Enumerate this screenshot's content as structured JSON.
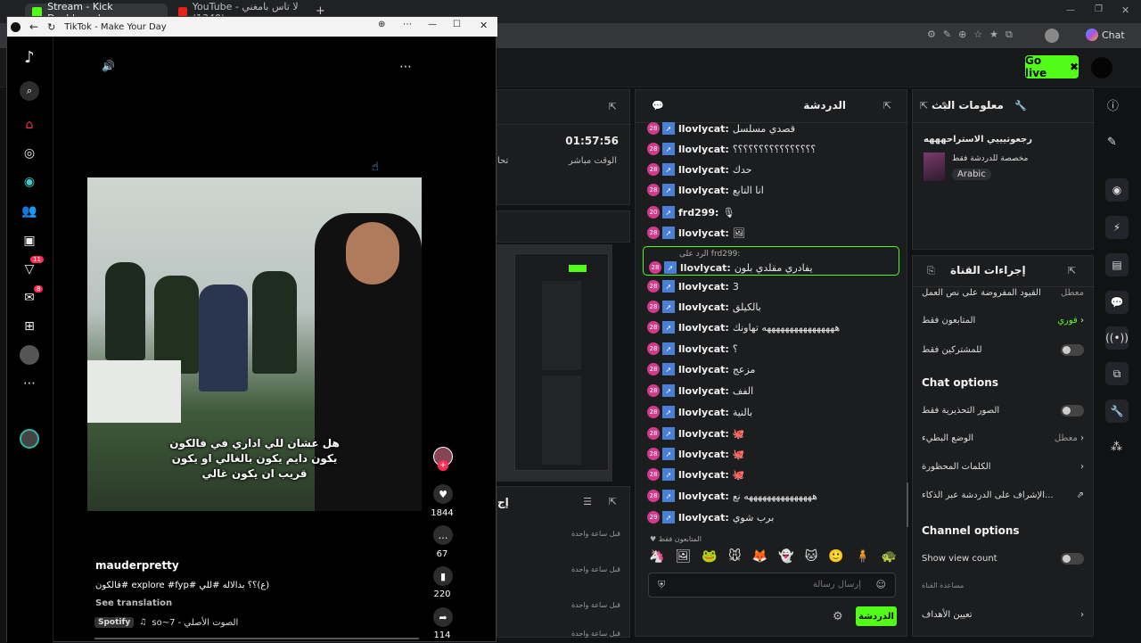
{
  "browser": {
    "tabs": [
      {
        "label": "Stream - Kick Dashboard"
      },
      {
        "label": "YouTube - لا تاس بامغني (1340)"
      }
    ],
    "new_tab": "+",
    "copilot": "Chat"
  },
  "kick": {
    "go_live": "Go live",
    "stats": {
      "time": "01:57:56",
      "time_label": "الوقت مباشر",
      "other_label": "تحا"
    },
    "stream_info": {
      "title": "معلومات البث",
      "stream_title": "رجعوتيييي الاستراحهههه",
      "category": "مخصصة للدردشة فقط",
      "language": "Arabic"
    },
    "chat": {
      "title": "الدردشة",
      "messages": [
        {
          "badge": "28",
          "user": "llovlycat:",
          "text": "قصدي مسلسل"
        },
        {
          "badge": "28",
          "user": "llovlycat:",
          "text": "؟؟؟؟؟؟؟؟؟؟؟؟؟؟؟؟"
        },
        {
          "badge": "28",
          "user": "llovlycat:",
          "text": "حدك"
        },
        {
          "badge": "28",
          "user": "llovlycat:",
          "text": "انا التابع"
        },
        {
          "badge": "20",
          "user": "frd299:",
          "text": "🎙"
        },
        {
          "badge": "28",
          "user": "llovlycat:",
          "text": "🖼"
        },
        {
          "badge": "28",
          "user": "llovlycat:",
          "text": "3"
        },
        {
          "badge": "28",
          "user": "llovlycat:",
          "text": "بالكيلق"
        },
        {
          "badge": "28",
          "user": "llovlycat:",
          "text": "ههههههههههههههههه تهاونك"
        },
        {
          "badge": "28",
          "user": "llovlycat:",
          "text": "؟"
        },
        {
          "badge": "28",
          "user": "llovlycat:",
          "text": "مزعج"
        },
        {
          "badge": "28",
          "user": "llovlycat:",
          "text": "الفف"
        },
        {
          "badge": "28",
          "user": "llovlycat:",
          "text": "بالنية"
        },
        {
          "badge": "28",
          "user": "llovlycat:",
          "text": "🐙"
        },
        {
          "badge": "28",
          "user": "llovlycat:",
          "text": "🐙"
        },
        {
          "badge": "28",
          "user": "llovlycat:",
          "text": "🐙"
        },
        {
          "badge": "28",
          "user": "llovlycat:",
          "text": "هههههههههههههههه نع"
        },
        {
          "badge": "29",
          "user": "llovlycat:",
          "text": "برب شوي"
        }
      ],
      "reply": {
        "ref": "الرد على frd299:",
        "user": "llovlycat:",
        "text": "يفادري مقلدي بلون"
      },
      "followers_only": "المتابعون فقط",
      "input_placeholder": "إرسال رسالة",
      "send": "الدردشة"
    },
    "channel_actions": {
      "title": "إجراءات القناة",
      "rows": [
        {
          "label": "القيود المفروضة على نص العمل",
          "value": "معطل"
        },
        {
          "label": "المتابعون فقط",
          "value": "فوري"
        },
        {
          "label": "للمشتركين فقط",
          "value": ""
        }
      ],
      "chat_options_title": "Chat options",
      "chat_options": [
        {
          "label": "الصور التحذيرية فقط",
          "value": ""
        },
        {
          "label": "الوضع البطيء",
          "value": "معطل"
        },
        {
          "label": "الكلمات المحظورة",
          "value": ""
        },
        {
          "label": "الإشراف على الدردشة عبر الذكاء...",
          "value": ""
        }
      ],
      "channel_options_title": "Channel options",
      "channel_options": [
        {
          "label": "Show view count",
          "value": ""
        },
        {
          "label": "مساعدة القناة",
          "value": ""
        },
        {
          "label": "تعيين الأهداف",
          "value": ""
        }
      ]
    },
    "lower_panel": {
      "title": "إج",
      "items": [
        "قبل ساعة واحدة",
        "قبل ساعة واحدة",
        "قبل ساعة واحدة",
        "قبل ساعة واحدة"
      ]
    }
  },
  "tiktok": {
    "window_title": "TikTok - Make Your Day",
    "nav_badges": {
      "activity": "11",
      "messages": "8"
    },
    "caption_lines": [
      "هل عشان للي اداري في فالكون",
      "يكون دايم يكون بالغالي او يكون",
      "قريب ان يكون غالي"
    ],
    "counts": {
      "likes": "1844",
      "comments": "67",
      "saves": "220",
      "shares": "114"
    },
    "author": "mauderpretty",
    "description": "(ع)؟؟ بدالاله #للي #explore #fyp #فالكون",
    "see_translation": "See translation",
    "spotify": "Spotify",
    "sound": "so~7 - الصوت الأصلي"
  }
}
